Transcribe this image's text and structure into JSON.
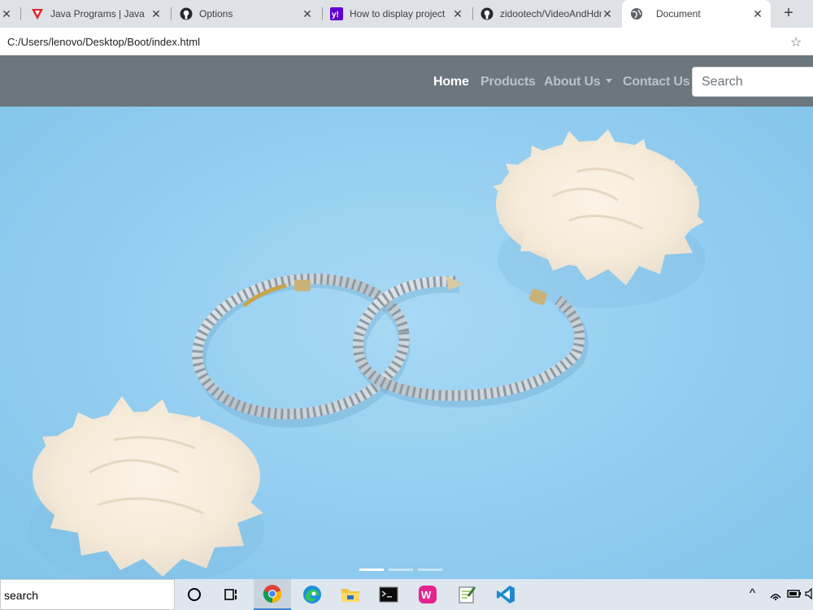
{
  "browser": {
    "tabs": [
      {
        "title": "Java Programs | Java Programming Examples",
        "icon": "javatpoint-icon",
        "active": false
      },
      {
        "title": "Options",
        "icon": "github-icon",
        "active": false
      },
      {
        "title": "How to display project",
        "icon": "yahoo-icon",
        "active": false
      },
      {
        "title": "zidootech/VideoAndHdmiIn",
        "icon": "github-icon",
        "active": false
      },
      {
        "title": "Document",
        "icon": "globe-icon",
        "active": true
      }
    ],
    "url": "C:/Users/lenovo/Desktop/Boot/index.html"
  },
  "navbar": {
    "links": [
      {
        "label": "Home",
        "active": true
      },
      {
        "label": "Products",
        "active": false
      },
      {
        "label": "About Us",
        "active": false,
        "dropdown": true
      },
      {
        "label": "Contact Us",
        "active": false
      }
    ],
    "search_placeholder": "Search"
  },
  "carousel": {
    "slide_count": 3,
    "active_slide": 1
  },
  "taskbar": {
    "search_text": "search",
    "apps": [
      "cortana-icon",
      "task-view-icon",
      "chrome-icon",
      "edge-icon",
      "file-explorer-icon",
      "terminal-icon",
      "wamp-icon",
      "notepad-plus-icon",
      "vscode-icon"
    ],
    "active_app": "chrome-icon"
  },
  "colors": {
    "navbar_bg": "#6b767d",
    "carousel_bg": "#8fcbee",
    "tabstrip_bg": "#dee1e6",
    "taskbar_bg": "#dfe6ee"
  }
}
